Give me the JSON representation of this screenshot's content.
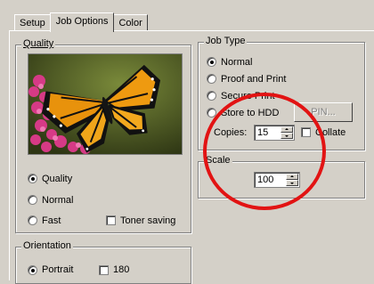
{
  "tabs": [
    {
      "label": "Setup"
    },
    {
      "label": "Job Options"
    },
    {
      "label": "Color"
    }
  ],
  "quality": {
    "title": "Quality",
    "options": [
      "Quality",
      "Normal",
      "Fast"
    ],
    "selected": "Quality",
    "toner_saving_label": "Toner saving",
    "toner_saving_checked": false
  },
  "orientation": {
    "title": "Orientation",
    "portrait_label": "Portrait",
    "rotate_label": "180"
  },
  "job_type": {
    "title": "Job Type",
    "options": [
      "Normal",
      "Proof and Print",
      "Secure Print",
      "Store to HDD"
    ],
    "selected": "Normal",
    "pin_label": "PIN...",
    "copies_label": "Copies:",
    "copies_value": "15",
    "collate_label": "Collate",
    "collate_checked": false
  },
  "scale": {
    "title": "Scale",
    "value": "100"
  },
  "colors": {
    "dialog_bg": "#d4d0c8",
    "annotation_ring": "#e21313"
  },
  "icons": [
    "butterfly-image",
    "spin-up-icon",
    "spin-down-icon",
    "annotation-circle"
  ]
}
